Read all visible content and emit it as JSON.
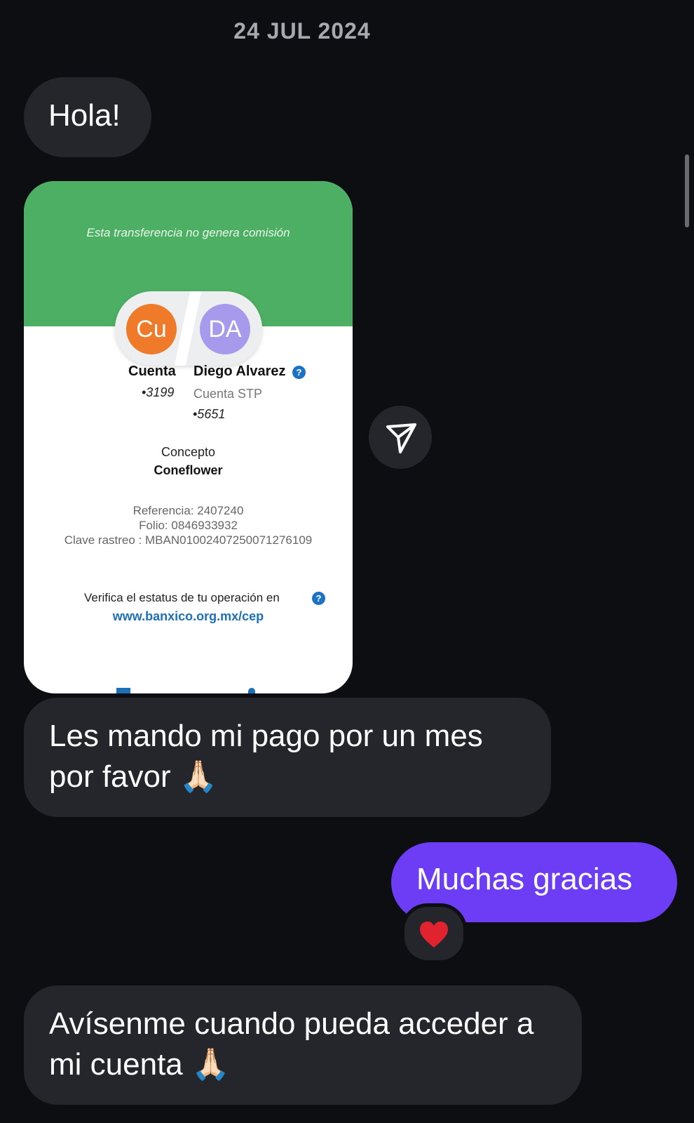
{
  "date": "24 JUL 2024",
  "messages": {
    "hola": "Hola!",
    "pago": "Les mando mi pago por un mes por favor 🙏🏻",
    "gracias": "Muchas gracias",
    "avisenme": "Avísenme cuando pueda acceder a mi cuenta 🙏🏻"
  },
  "reaction": "❤️",
  "receipt": {
    "note": "Esta transferencia no genera comisión",
    "from_initials": "Cu",
    "to_initials": "DA",
    "from_name": "Cuenta",
    "from_account": "•3199",
    "to_name": "Diego Alvarez",
    "to_bank": "Cuenta STP",
    "to_account": "•5651",
    "help_icon": "?",
    "concept_label": "Concepto",
    "concept_value": "Coneflower",
    "referencia": "Referencia: 2407240",
    "folio": "Folio: 0846933932",
    "clave": "Clave rastreo : MBAN01002407250071276109",
    "verify_text": "Verifica el estatus de tu operación en",
    "verify_link": "www.banxico.org.mx/cep"
  },
  "icons": {
    "share": "paper-plane-icon",
    "help": "question-icon"
  },
  "colors": {
    "background": "#0d0e12",
    "incoming_bubble": "#25262c",
    "outgoing_bubble": "#6c3df4",
    "receipt_green": "#4caf63",
    "avatar_cu": "#ef7a2a",
    "avatar_da": "#a79aec"
  }
}
